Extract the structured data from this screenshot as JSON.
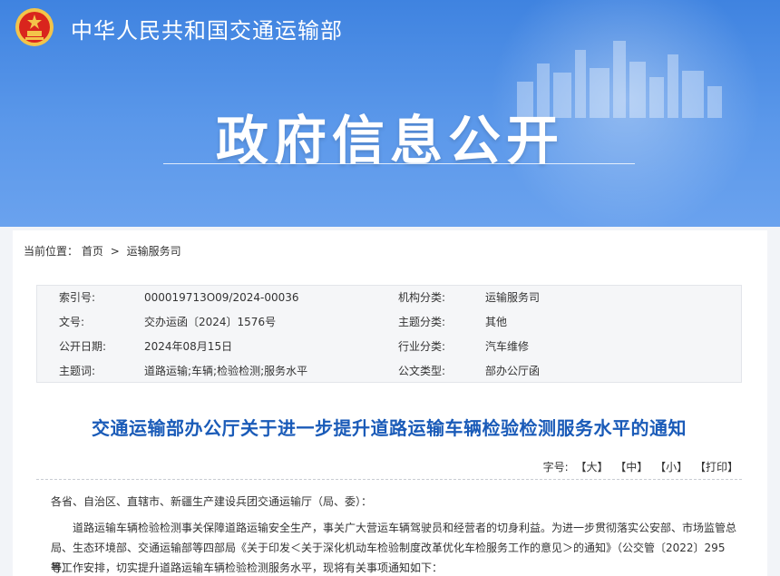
{
  "header": {
    "ministry_name": "中华人民共和国交通运输部",
    "section_title": "政府信息公开"
  },
  "breadcrumb": {
    "prefix": "当前位置：",
    "items": [
      "首页",
      "运输服务司"
    ],
    "separator": ">"
  },
  "info_table": {
    "rows": [
      {
        "label1": "索引号:",
        "value1": "000019713O09/2024-00036",
        "label2": "机构分类:",
        "value2": "运输服务司"
      },
      {
        "label1": "文号:",
        "value1": "交办运函〔2024〕1576号",
        "label2": "主题分类:",
        "value2": "其他"
      },
      {
        "label1": "公开日期:",
        "value1": "2024年08月15日",
        "label2": "行业分类:",
        "value2": "汽车维修"
      },
      {
        "label1": "主题词:",
        "value1": "道路运输;车辆;检验检测;服务水平",
        "label2": "公文类型:",
        "value2": "部办公厅函"
      }
    ]
  },
  "document": {
    "title": "交通运输部办公厅关于进一步提升道路运输车辆检验检测服务水平的通知",
    "salutation": "各省、自治区、直辖市、新疆生产建设兵团交通运输厅（局、委）：",
    "paragraph_line1": "道路运输车辆检验检测事关保障道路运输安全生产，事关广大营运车辆驾驶员和经营者的切身利益。为进一步贯彻落实公安部、市场监管总",
    "paragraph_line2": "局、生态环境部、交通运输部等四部局《关于印发＜关于深化机动车检验制度改革优化车检服务工作的意见＞的通知》（公交管〔2022〕295号）",
    "paragraph_line3": "等工作安排，切实提升道路运输车辆检验检测服务水平，现将有关事项通知如下："
  },
  "font_size_controls": {
    "label": "字号:",
    "large": "【大】",
    "medium": "【中】",
    "small": "【小】",
    "print": "【打印】"
  },
  "colors": {
    "banner_blue": "#3f83e0",
    "title_blue": "#1a5bb8",
    "emblem_red": "#d9251d",
    "emblem_gold": "#f3c44a"
  },
  "icons": {
    "emblem": "national-emblem-icon"
  }
}
